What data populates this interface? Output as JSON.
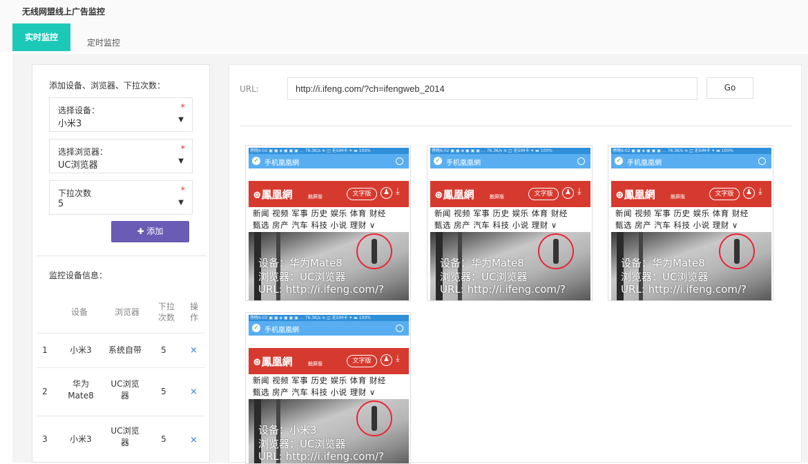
{
  "app": {
    "title": "无线网盟线上广告监控"
  },
  "tabs": [
    {
      "label": "实时监控"
    },
    {
      "label": "定时监控"
    }
  ],
  "left": {
    "add_heading": "添加设备、浏览器、下拉次数：",
    "device": {
      "label": "选择设备：",
      "value": "小米3"
    },
    "browser": {
      "label": "选择浏览器：",
      "value": "UC浏览器"
    },
    "pulls": {
      "label": "下拉次数",
      "value": "5"
    },
    "required_mark": "*",
    "add_button": "✚ 添加",
    "info_heading": "监控设备信息：",
    "columns": {
      "device": "设备",
      "browser": "浏览器",
      "pulls": "下拉\n次数",
      "op": "操\n作"
    },
    "rows": [
      {
        "index": "1",
        "device": "小米3",
        "browser": "系统自带",
        "pulls": "5",
        "delete": "×"
      },
      {
        "index": "2",
        "device": "华为\nMate8",
        "browser": "UC浏览\n器",
        "pulls": "5",
        "delete": "×"
      },
      {
        "index": "3",
        "device": "小米3",
        "browser": "UC浏览\n器",
        "pulls": "5",
        "delete": "×"
      }
    ]
  },
  "right": {
    "url_label": "URL:",
    "url_value": "http://i.ifeng.com/?ch=ifengweb_2014",
    "go_label": "Go"
  },
  "preview_common": {
    "status": "傍晚6:02 ▣ ▣ ◈ ▣ ▣ ▣ … 76.3K/s ≋ ◫ 无SIM卡 ✦ ▬ 100%",
    "site_name": "手机凰凰網",
    "logo": "⊛鳳凰網",
    "logo_sub": "触屏版",
    "text_version": "文字版",
    "nav_row1": "新闻 视频 军事 历史 娱乐 体育 财经",
    "nav_row2": "甄选 房产 汽车 科技 小说 理财 ∨"
  },
  "previews": [
    {
      "device_line": "设备：华为Mate8",
      "browser_line": "浏览器：UC浏览器",
      "url_line": "URL: http://i.ifeng.com/?"
    },
    {
      "device_line": "设备：华为Mate8",
      "browser_line": "浏览器：UC浏览器",
      "url_line": "URL: http://i.ifeng.com/?"
    },
    {
      "device_line": "设备：华为Mate8",
      "browser_line": "浏览器：UC浏览器",
      "url_line": "URL: http://i.ifeng.com/?"
    },
    {
      "device_line": "设备：小米3",
      "browser_line": "浏览器：UC浏览器",
      "url_line": "URL: http://i.ifeng.com/?"
    }
  ],
  "colors": {
    "accent": "#1cc9b8",
    "add_button": "#6a5bb5",
    "brand_red": "#d63a2f",
    "status_blue": "#2f8fd9"
  },
  "icons": {
    "ok": "check-circle-icon",
    "user": "user-icon",
    "download": "download-icon",
    "caret": "caret-down-icon",
    "delete": "close-icon"
  }
}
